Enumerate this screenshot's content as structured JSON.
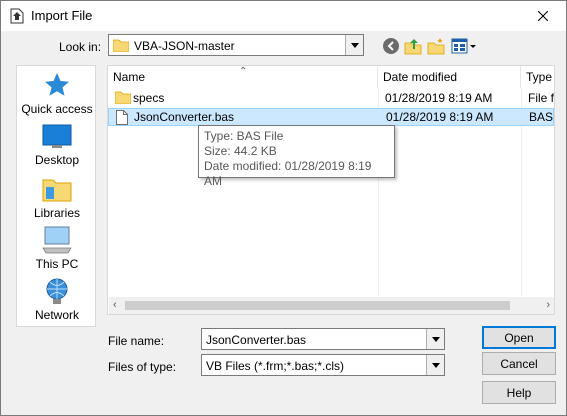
{
  "window": {
    "title": "Import File"
  },
  "lookin": {
    "label": "Look in:",
    "value": "VBA-JSON-master"
  },
  "places": [
    {
      "label": "Quick access",
      "icon": "quick-access-star-icon"
    },
    {
      "label": "Desktop",
      "icon": "desktop-icon"
    },
    {
      "label": "Libraries",
      "icon": "libraries-icon"
    },
    {
      "label": "This PC",
      "icon": "this-pc-icon"
    },
    {
      "label": "Network",
      "icon": "network-icon"
    }
  ],
  "columns": [
    "Name",
    "Date modified",
    "Type"
  ],
  "files": [
    {
      "name": "specs",
      "date": "01/28/2019 8:19 AM",
      "type": "File fo",
      "icon": "folder-icon"
    },
    {
      "name": "JsonConverter.bas",
      "date": "01/28/2019 8:19 AM",
      "type": "BAS F",
      "icon": "file-icon",
      "selected": true
    }
  ],
  "tooltip": {
    "type": "Type: BAS File",
    "size": "Size: 44.2 KB",
    "modified": "Date modified: 01/28/2019 8:19 AM"
  },
  "filename": {
    "label": "File name:",
    "value": "JsonConverter.bas"
  },
  "filetype": {
    "label": "Files of type:",
    "value": "VB Files (*.frm;*.bas;*.cls)"
  },
  "buttons": {
    "open": "Open",
    "cancel": "Cancel",
    "help": "Help"
  },
  "colors": {
    "accent": "#0078d7",
    "selection": "#cce8ff",
    "folder": "#f8d775"
  }
}
